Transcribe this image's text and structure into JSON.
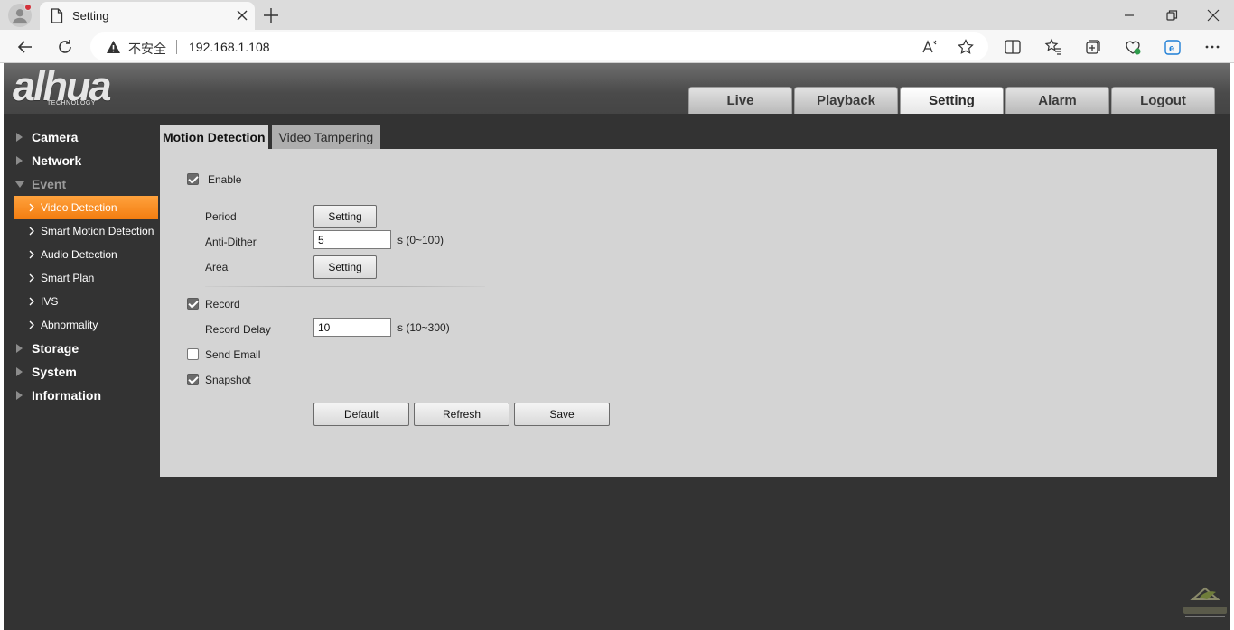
{
  "browser": {
    "tab_title": "Setting",
    "security_label": "不安全",
    "url": "192.168.1.108"
  },
  "header": {
    "logo_text": "alhua",
    "logo_sub": "TECHNOLOGY",
    "nav": [
      {
        "label": "Live"
      },
      {
        "label": "Playback"
      },
      {
        "label": "Setting"
      },
      {
        "label": "Alarm"
      },
      {
        "label": "Logout"
      }
    ]
  },
  "sidebar": {
    "camera": "Camera",
    "network": "Network",
    "event": "Event",
    "event_items": [
      "Video Detection",
      "Smart Motion Detection",
      "Audio Detection",
      "Smart Plan",
      "IVS",
      "Abnormality"
    ],
    "storage": "Storage",
    "system": "System",
    "information": "Information"
  },
  "content": {
    "tabs": [
      "Motion Detection",
      "Video Tampering"
    ],
    "enable_label": "Enable",
    "period_label": "Period",
    "period_button": "Setting",
    "anti_dither_label": "Anti-Dither",
    "anti_dither_value": "5",
    "anti_dither_range": "s (0~100)",
    "area_label": "Area",
    "area_button": "Setting",
    "record_label": "Record",
    "record_delay_label": "Record Delay",
    "record_delay_value": "10",
    "record_delay_range": "s (10~300)",
    "send_email_label": "Send Email",
    "snapshot_label": "Snapshot",
    "default_button": "Default",
    "refresh_button": "Refresh",
    "save_button": "Save"
  }
}
